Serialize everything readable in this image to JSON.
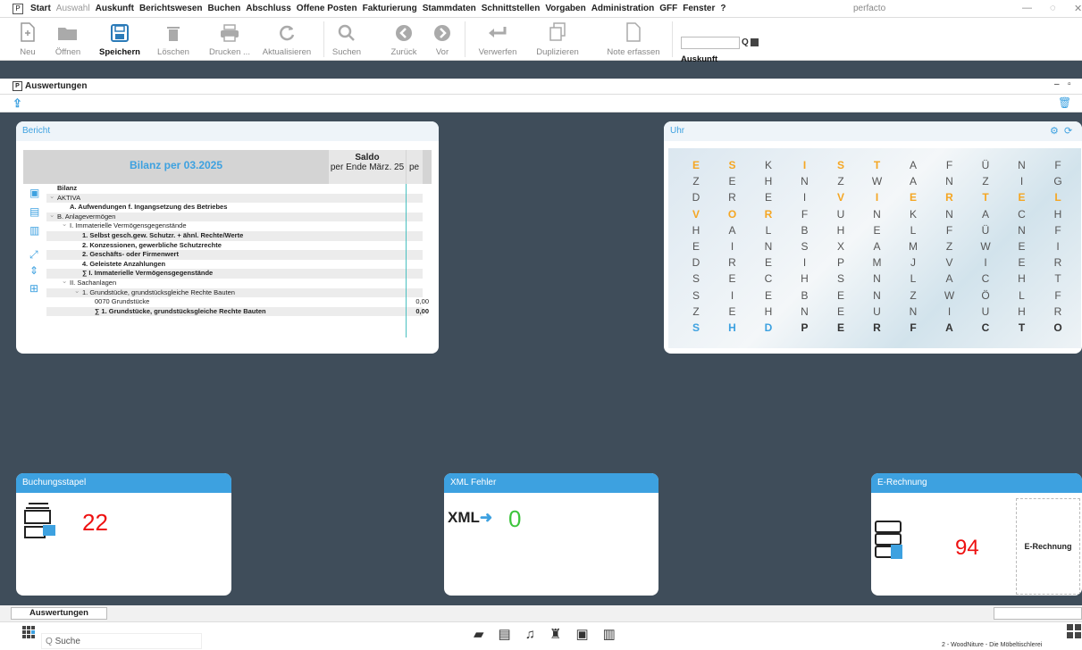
{
  "menubar": {
    "items": [
      {
        "label": "Start",
        "enabled": true
      },
      {
        "label": "Auswahl",
        "enabled": false
      },
      {
        "label": "Auskunft",
        "enabled": true
      },
      {
        "label": "Berichtswesen",
        "enabled": true
      },
      {
        "label": "Buchen",
        "enabled": true
      },
      {
        "label": "Abschluss",
        "enabled": true
      },
      {
        "label": "Offene Posten",
        "enabled": true
      },
      {
        "label": "Fakturierung",
        "enabled": true
      },
      {
        "label": "Stammdaten",
        "enabled": true
      },
      {
        "label": "Schnittstellen",
        "enabled": true
      },
      {
        "label": "Vorgaben",
        "enabled": true
      },
      {
        "label": "Administration",
        "enabled": true
      },
      {
        "label": "GFF",
        "enabled": true
      },
      {
        "label": "Fenster",
        "enabled": true
      },
      {
        "label": "?",
        "enabled": true
      }
    ],
    "app_title": "perfacto"
  },
  "toolbar": {
    "neu": "Neu",
    "oeffnen": "Öffnen",
    "speichern": "Speichern",
    "loeschen": "Löschen",
    "drucken": "Drucken ...",
    "aktualisieren": "Aktualisieren",
    "suchen": "Suchen",
    "zurueck": "Zurück",
    "vor": "Vor",
    "verwerfen": "Verwerfen",
    "duplizieren": "Duplizieren",
    "note": "Note erfassen",
    "search_value": "",
    "auskunft": "Auskunft"
  },
  "module": {
    "title": "Auswertungen"
  },
  "bericht": {
    "header": "Bericht",
    "table_title": "Bilanz per 03.2025",
    "col_saldo": "Saldo",
    "col_saldo_sub": "per Ende März. 25",
    "col_partial": "pe",
    "rows": [
      {
        "label": "Bilanz",
        "indent": 0,
        "bold": true,
        "value": ""
      },
      {
        "label": "AKTIVA",
        "indent": 0,
        "bold": false,
        "value": "",
        "chevron": true
      },
      {
        "label": "A. Aufwendungen f. Ingangsetzung des Betriebes",
        "indent": 1,
        "bold": true,
        "value": ""
      },
      {
        "label": "B. Anlagevermögen",
        "indent": 0,
        "bold": false,
        "value": "",
        "chevron": true
      },
      {
        "label": "I. Immaterielle Vermögensgegenstände",
        "indent": 1,
        "bold": false,
        "value": "",
        "chevron": true
      },
      {
        "label": "1. Selbst gesch.gew. Schutzr. + ähnl. Rechte/Werte",
        "indent": 2,
        "bold": true,
        "value": ""
      },
      {
        "label": "2. Konzessionen, gewerbliche Schutzrechte",
        "indent": 2,
        "bold": true,
        "value": ""
      },
      {
        "label": "2. Geschäfts- oder Firmenwert",
        "indent": 2,
        "bold": true,
        "value": ""
      },
      {
        "label": "4. Geleistete Anzahlungen",
        "indent": 2,
        "bold": true,
        "value": ""
      },
      {
        "label": "∑ I. Immaterielle Vermögensgegenstände",
        "indent": 2,
        "bold": true,
        "value": ""
      },
      {
        "label": "II. Sachanlagen",
        "indent": 1,
        "bold": false,
        "value": "",
        "chevron": true
      },
      {
        "label": "1. Grundstücke, grundstücksgleiche Rechte Bauten",
        "indent": 2,
        "bold": false,
        "value": "",
        "chevron": true
      },
      {
        "label": "0070 Grundstücke",
        "indent": 3,
        "bold": false,
        "value": "0,00"
      },
      {
        "label": "∑ 1. Grundstücke, grundstücksgleiche Rechte Bauten",
        "indent": 3,
        "bold": true,
        "value": "0,00"
      }
    ]
  },
  "uhr": {
    "header": "Uhr",
    "grid": [
      [
        "E",
        "S",
        "K",
        "I",
        "S",
        "T",
        "A",
        "F",
        "Ü",
        "N",
        "F"
      ],
      [
        "Z",
        "E",
        "H",
        "N",
        "Z",
        "W",
        "A",
        "N",
        "Z",
        "I",
        "G"
      ],
      [
        "D",
        "R",
        "E",
        "I",
        "V",
        "I",
        "E",
        "R",
        "T",
        "E",
        "L"
      ],
      [
        "V",
        "O",
        "R",
        "F",
        "U",
        "N",
        "K",
        "N",
        "A",
        "C",
        "H"
      ],
      [
        "H",
        "A",
        "L",
        "B",
        "H",
        "E",
        "L",
        "F",
        "Ü",
        "N",
        "F"
      ],
      [
        "E",
        "I",
        "N",
        "S",
        "X",
        "A",
        "M",
        "Z",
        "W",
        "E",
        "I"
      ],
      [
        "D",
        "R",
        "E",
        "I",
        "P",
        "M",
        "J",
        "V",
        "I",
        "E",
        "R"
      ],
      [
        "S",
        "E",
        "C",
        "H",
        "S",
        "N",
        "L",
        "A",
        "C",
        "H",
        "T"
      ],
      [
        "S",
        "I",
        "E",
        "B",
        "E",
        "N",
        "Z",
        "W",
        "Ö",
        "L",
        "F"
      ],
      [
        "Z",
        "E",
        "H",
        "N",
        "E",
        "U",
        "N",
        "I",
        "U",
        "H",
        "R"
      ],
      [
        "S",
        "H",
        "D",
        "P",
        "E",
        "R",
        "F",
        "A",
        "C",
        "T",
        "O"
      ]
    ],
    "highlight": {
      "orange": [
        [
          0,
          0
        ],
        [
          0,
          1
        ],
        [
          0,
          3
        ],
        [
          0,
          4
        ],
        [
          0,
          5
        ],
        [
          2,
          4
        ],
        [
          2,
          5
        ],
        [
          2,
          6
        ],
        [
          2,
          7
        ],
        [
          2,
          8
        ],
        [
          2,
          9
        ],
        [
          2,
          10
        ],
        [
          3,
          0
        ],
        [
          3,
          1
        ],
        [
          3,
          2
        ]
      ],
      "blue": [
        [
          10,
          0
        ],
        [
          10,
          1
        ],
        [
          10,
          2
        ]
      ],
      "dark": [
        [
          10,
          3
        ],
        [
          10,
          4
        ],
        [
          10,
          5
        ],
        [
          10,
          6
        ],
        [
          10,
          7
        ],
        [
          10,
          8
        ],
        [
          10,
          9
        ],
        [
          10,
          10
        ]
      ]
    }
  },
  "buchungsstapel": {
    "header": "Buchungsstapel",
    "count": "22"
  },
  "xmlfehler": {
    "header": "XML Fehler",
    "count": "0",
    "icon_text": "XML"
  },
  "erechnung": {
    "header": "E-Rechnung",
    "count": "94",
    "button": "E-Rechnung"
  },
  "bottom": {
    "tab": "Auswertungen",
    "search_placeholder": "Suche",
    "status_text": "2 - WoodNiture - Die Möbeltischlerei"
  }
}
